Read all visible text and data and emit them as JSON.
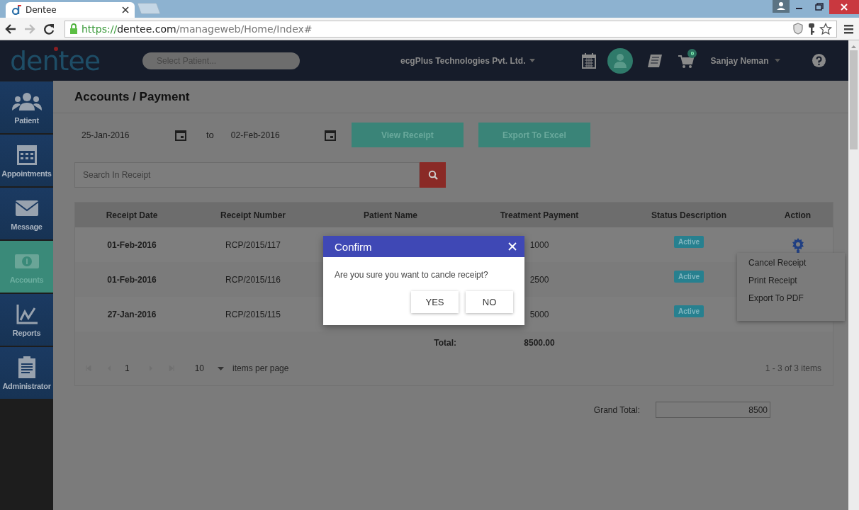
{
  "browser": {
    "tab_title": "Dentee",
    "url_scheme": "https://",
    "url_host": "dentee.com",
    "url_path": "/manageweb/Home/Index#"
  },
  "header": {
    "logo": "dentee",
    "patient_search": {
      "placeholder": "Select Patient..."
    },
    "company": "ecgPlus Technologies Pvt. Ltd.",
    "cart_count": "0",
    "user": "Sanjay Neman"
  },
  "sidebar": {
    "items": [
      {
        "label": "Patient",
        "selected": false
      },
      {
        "label": "Appointments",
        "selected": false
      },
      {
        "label": "Message",
        "selected": false
      },
      {
        "label": "Accounts",
        "selected": true
      },
      {
        "label": "Reports",
        "selected": false
      },
      {
        "label": "Administrator",
        "selected": false
      }
    ]
  },
  "page": {
    "title": "Accounts / Payment",
    "from_date": "25-Jan-2016",
    "to_label": "to",
    "to_date": "02-Feb-2016",
    "buttons": [
      "View Receipt",
      "Export To Excel"
    ],
    "search": {
      "placeholder": "Search In Receipt"
    }
  },
  "table": {
    "columns": [
      "Receipt Date",
      "Receipt Number",
      "Patient Name",
      "Treatment Payment",
      "Status Description",
      "Action"
    ],
    "rows": [
      {
        "receipt_date": "01-Feb-2016",
        "receipt_number": "RCP/2015/117",
        "treatment_payment": "1000",
        "status": "Active"
      },
      {
        "receipt_date": "01-Feb-2016",
        "receipt_number": "RCP/2015/116",
        "treatment_payment": "2500",
        "status": "Active"
      },
      {
        "receipt_date": "27-Jan-2016",
        "receipt_number": "RCP/2015/115",
        "treatment_payment": "5000",
        "status": "Active"
      }
    ],
    "total_label": "Total:",
    "total": "8500.00"
  },
  "pager": {
    "page": "1",
    "page_size": "10",
    "page_size_label": "items per page",
    "summary": "1 - 3 of 3 items"
  },
  "grand_total": {
    "label": "Grand Total:",
    "value": "8500"
  },
  "action_menu": {
    "items": [
      "Cancel Receipt",
      "Print Receipt",
      "Export To PDF"
    ]
  },
  "dialog": {
    "title": "Confirm",
    "message": "Are you sure you want to cancle receipt?",
    "buttons": [
      "YES",
      "NO"
    ]
  }
}
